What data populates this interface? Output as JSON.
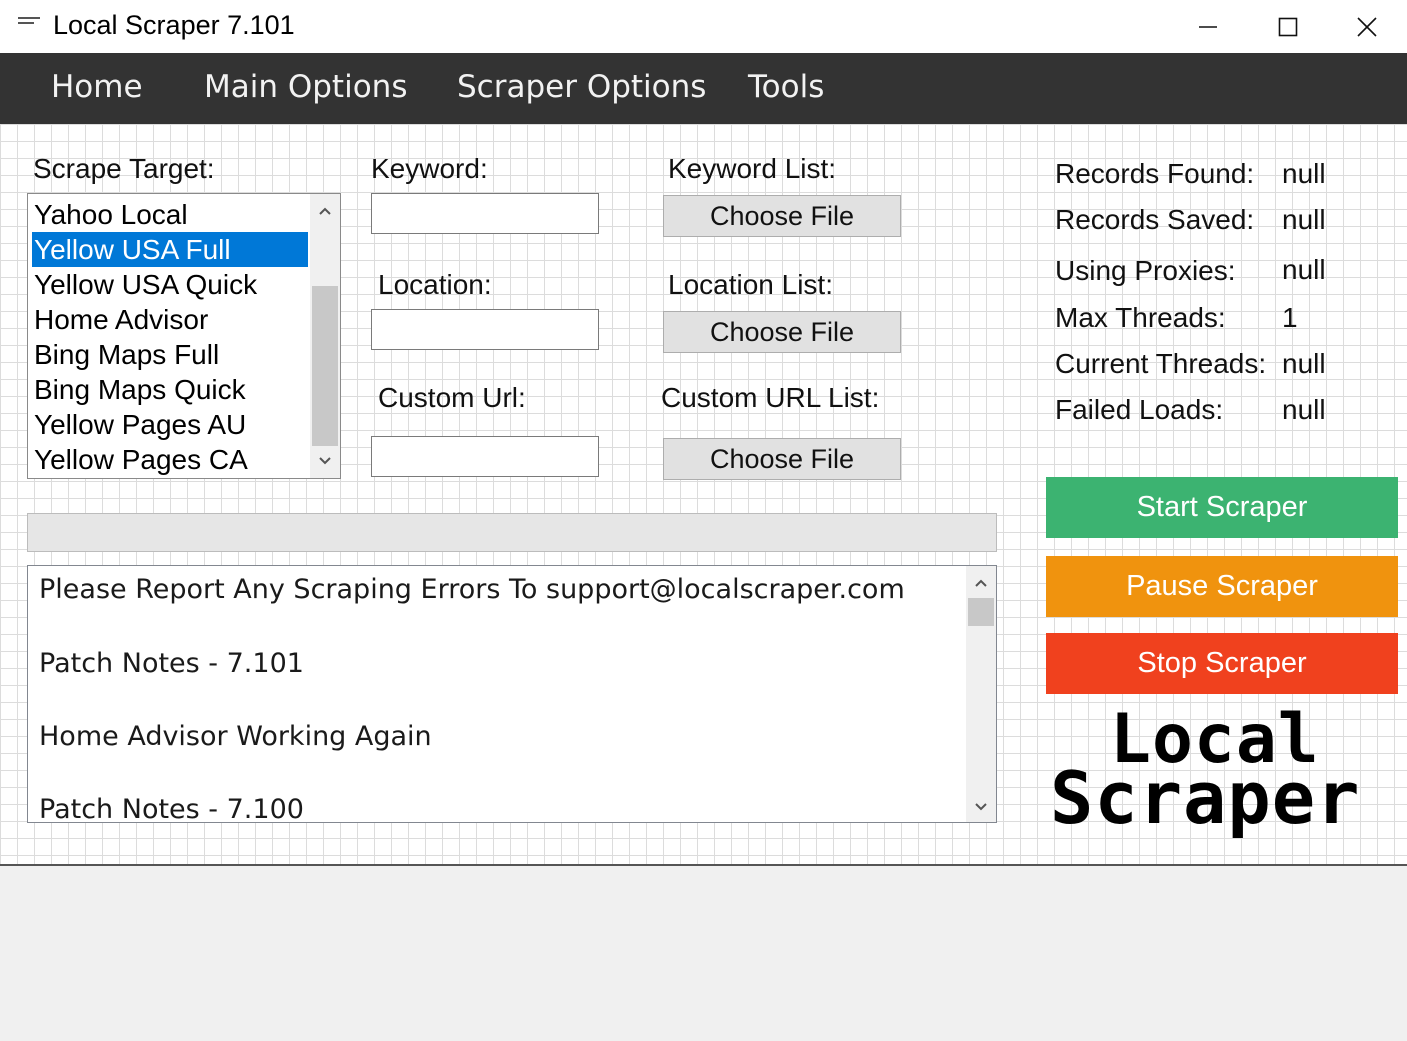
{
  "window": {
    "title": "Local Scraper 7.101"
  },
  "menu": {
    "items": [
      "Home",
      "Main Options",
      "Scraper Options",
      "Tools"
    ]
  },
  "scrape_target": {
    "label": "Scrape Target:",
    "options": [
      "Yahoo Local",
      "Yellow USA Full",
      "Yellow USA Quick",
      "Home Advisor",
      "Bing Maps Full",
      "Bing Maps Quick",
      "Yellow Pages AU",
      "Yellow Pages CA"
    ],
    "selected": "Yellow USA Full"
  },
  "inputs": {
    "keyword_label": "Keyword:",
    "keyword_value": "",
    "location_label": "Location:",
    "location_value": "",
    "custom_url_label": "Custom Url:",
    "custom_url_value": ""
  },
  "file_lists": {
    "keyword_list_label": "Keyword List:",
    "location_list_label": "Location List:",
    "custom_url_list_label": "Custom URL List:",
    "choose_file_label": "Choose File"
  },
  "progress": {
    "value": 0
  },
  "log": {
    "lines": [
      "Please Report Any Scraping Errors To support@localscraper.com",
      "Patch Notes - 7.101",
      "Home Advisor Working Again",
      "Patch Notes - 7.100"
    ]
  },
  "stats": [
    {
      "label": "Records Found:",
      "value": "null"
    },
    {
      "label": "Records Saved:",
      "value": "null"
    },
    {
      "label": "Using Proxies:",
      "value": "null"
    },
    {
      "label": "Max Threads:",
      "value": "1"
    },
    {
      "label": "Current Threads:",
      "value": "null"
    },
    {
      "label": "Failed Loads:",
      "value": "null"
    }
  ],
  "actions": {
    "start_label": "Start Scraper",
    "pause_label": "Pause Scraper",
    "stop_label": "Stop Scraper",
    "start_color": "#3cb371",
    "pause_color": "#f0930e",
    "stop_color": "#f0411e"
  },
  "logo": {
    "line1": "Local",
    "line2": "Scraper"
  },
  "icons": {
    "app": "app-icon",
    "minimize": "minimize-icon",
    "maximize": "maximize-icon",
    "close": "close-icon",
    "scroll_up": "chevron-up-icon",
    "scroll_down": "chevron-down-icon"
  }
}
